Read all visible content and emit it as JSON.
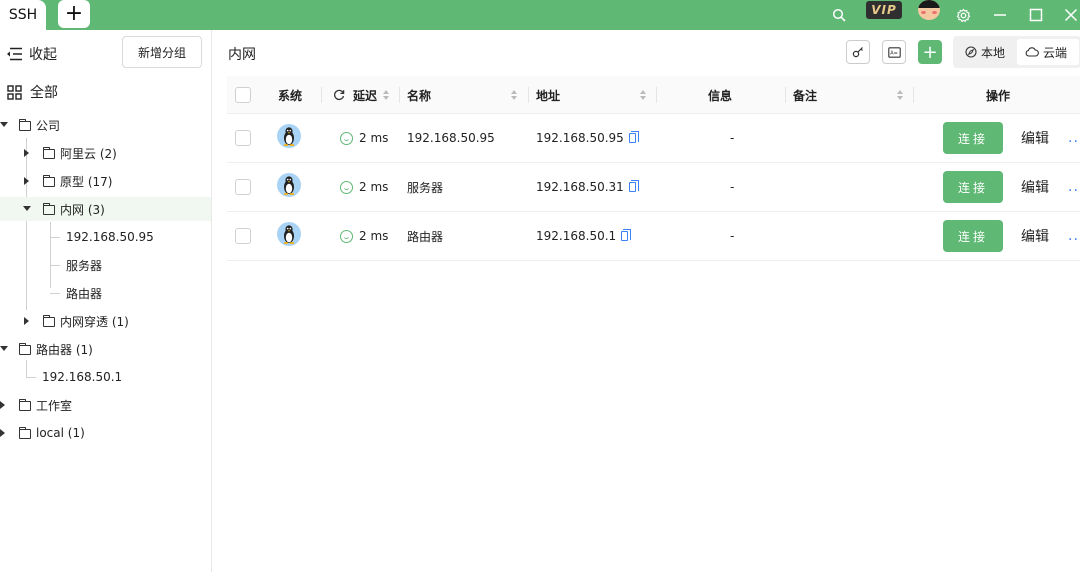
{
  "titlebar": {
    "tab_label": "SSH",
    "add_tab": "+",
    "vip_label": "VIP",
    "accent_color": "#5fb874"
  },
  "sidebar": {
    "collapse_label": "收起",
    "new_group_label": "新增分组",
    "all_label": "全部",
    "tree": [
      {
        "label": "公司",
        "expanded": true,
        "level": 0
      },
      {
        "label": "阿里云 (2)",
        "expanded": false,
        "level": 1
      },
      {
        "label": "原型 (17)",
        "expanded": false,
        "level": 1
      },
      {
        "label": "内网 (3)",
        "expanded": true,
        "level": 1,
        "active": true
      },
      {
        "label": "192.168.50.95",
        "level": 2,
        "leaf": true
      },
      {
        "label": "服务器",
        "level": 2,
        "leaf": true
      },
      {
        "label": "路由器",
        "level": 2,
        "leaf": true
      },
      {
        "label": "内网穿透 (1)",
        "expanded": false,
        "level": 1
      },
      {
        "label": "路由器 (1)",
        "expanded": true,
        "level": 0
      },
      {
        "label": "192.168.50.1",
        "level": 1,
        "leaf": true
      },
      {
        "label": "工作室",
        "expanded": false,
        "level": 0
      },
      {
        "label": "local (1)",
        "expanded": false,
        "level": 0
      }
    ]
  },
  "main": {
    "title": "内网",
    "add_label": "+",
    "seg_local": "本地",
    "seg_cloud": "云端",
    "columns": {
      "system": "系统",
      "latency": "延迟",
      "name": "名称",
      "address": "地址",
      "info": "信息",
      "remark": "备注",
      "actions": "操作"
    },
    "rows": [
      {
        "latency": "2 ms",
        "name": "192.168.50.95",
        "address": "192.168.50.95",
        "info": "-",
        "connect": "连接",
        "edit": "编辑",
        "more": "..."
      },
      {
        "latency": "2 ms",
        "name": "服务器",
        "address": "192.168.50.31",
        "info": "-",
        "connect": "连接",
        "edit": "编辑",
        "more": "..."
      },
      {
        "latency": "2 ms",
        "name": "路由器",
        "address": "192.168.50.1",
        "info": "-",
        "connect": "连接",
        "edit": "编辑",
        "more": "..."
      }
    ]
  }
}
